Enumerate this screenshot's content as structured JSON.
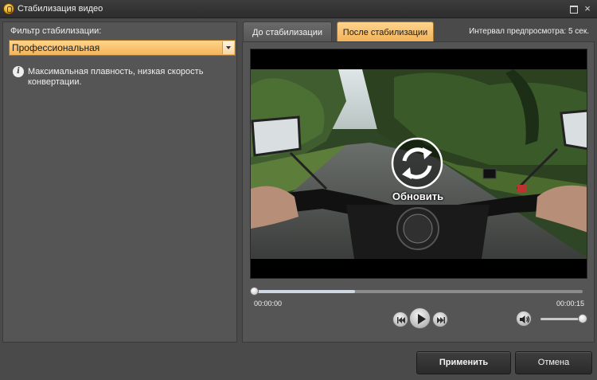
{
  "window": {
    "title": "Стабилизация видео",
    "close_glyph": "×"
  },
  "left": {
    "filter_label": "Фильтр стабилизации:",
    "filter_value": "Профессиональная",
    "info_text": "Максимальная плавность, низкая скорость конвертации."
  },
  "tabs": [
    {
      "label": "До стабилизации",
      "active": false
    },
    {
      "label": "После стабилизации",
      "active": true
    }
  ],
  "preview": {
    "interval_text": "Интервал предпросмотра: 5 сек.",
    "overlay_label": "Обновить"
  },
  "player": {
    "time_start": "00:00:00",
    "time_end": "00:00:15",
    "progress_fraction": 0.31,
    "volume_fraction": 1.0
  },
  "footer": {
    "apply_label": "Применить",
    "cancel_label": "Отмена"
  },
  "colors": {
    "accent": "#f3b35a",
    "background": "#4a4a4a",
    "panel": "#555555"
  },
  "icons": {
    "app": "app-icon",
    "maximize": "maximize-icon",
    "close": "close-icon",
    "info": "info-icon",
    "dropdown": "chevron-down-icon",
    "refresh": "refresh-icon",
    "prev": "skip-back-icon",
    "play": "play-icon",
    "next": "skip-forward-icon",
    "volume": "volume-icon"
  }
}
